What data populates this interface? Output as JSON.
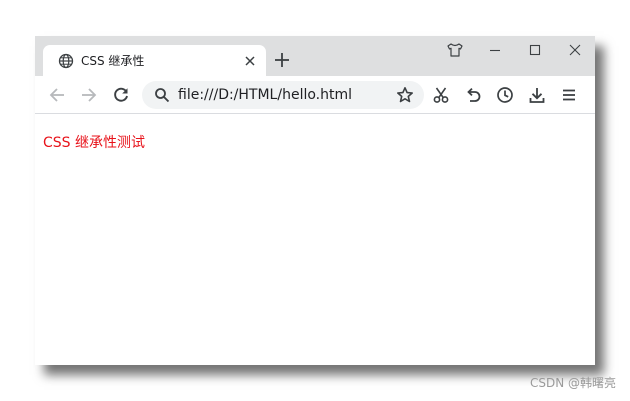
{
  "tab": {
    "title": "CSS 继承性",
    "favicon": "globe-icon"
  },
  "toolbar": {
    "url": "file:///D:/HTML/hello.html",
    "buttons": [
      "back-icon",
      "forward-icon",
      "reload-icon",
      "search-icon",
      "bookmark-star-icon",
      "cut-icon",
      "undo-icon",
      "history-icon",
      "download-icon",
      "menu-icon"
    ]
  },
  "window_controls": [
    "shirt-icon",
    "minimize-icon",
    "maximize-icon",
    "close-icon"
  ],
  "page": {
    "text": "CSS 继承性测试",
    "text_color": "#e8121a"
  },
  "watermark": "CSDN @韩曙亮",
  "colors": {
    "tabstrip": "#dedfe0",
    "omnibox": "#f1f3f4",
    "icon": "#5f6368"
  }
}
